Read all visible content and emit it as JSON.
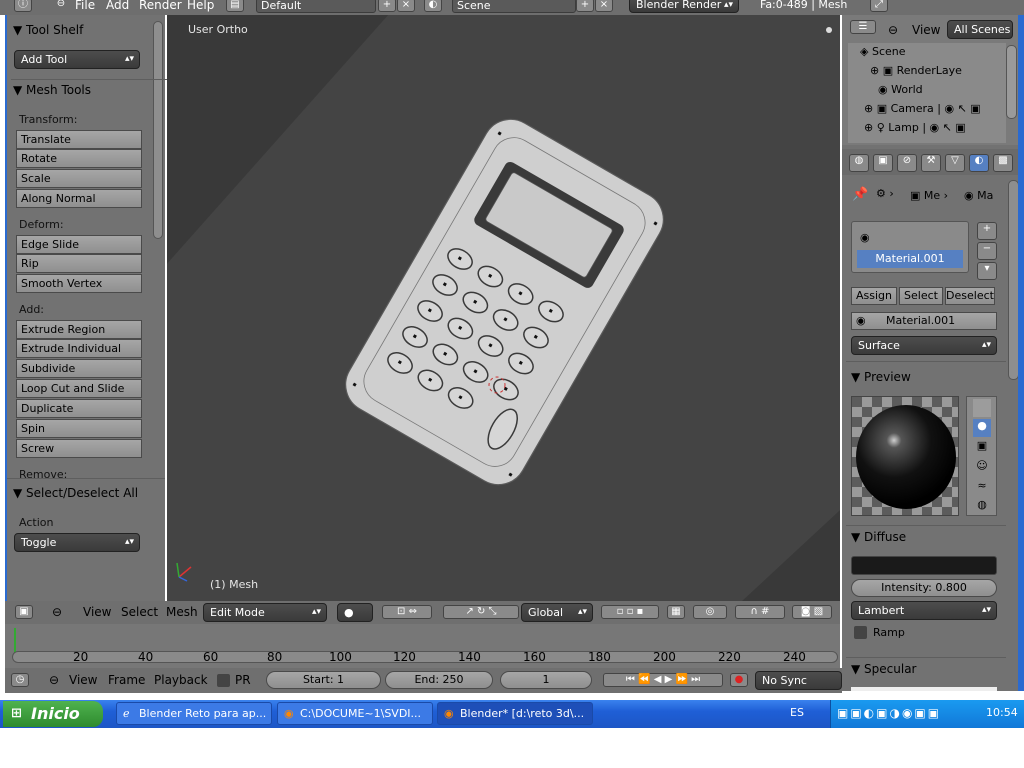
{
  "top_header": {
    "menus": [
      "File",
      "Add",
      "Render",
      "Help"
    ],
    "layout": "Default",
    "scene": "Scene",
    "engine": "Blender Render",
    "stats": "Fa:0-489 | Mesh"
  },
  "tool_shelf": {
    "title": "Tool Shelf",
    "add_tool": "Add Tool",
    "mesh_tools_title": "Mesh Tools",
    "transform_label": "Transform:",
    "transform": [
      "Translate",
      "Rotate",
      "Scale",
      "Along Normal"
    ],
    "deform_label": "Deform:",
    "deform": [
      "Edge Slide",
      "Rip",
      "Smooth Vertex"
    ],
    "add_label": "Add:",
    "add": [
      "Extrude Region",
      "Extrude Individual",
      "Subdivide",
      "Loop Cut and Slide",
      "Duplicate",
      "Spin",
      "Screw"
    ],
    "remove_label": "Remove:",
    "select_all_title": "Select/Deselect All",
    "action_label": "Action",
    "action_value": "Toggle"
  },
  "viewport": {
    "view_name": "User Ortho",
    "object_label": "(1) Mesh",
    "bg_color": "#393939",
    "model_color": "#c8c8c8"
  },
  "view3d_header": {
    "menus": [
      "View",
      "Select",
      "Mesh"
    ],
    "mode": "Edit Mode",
    "orientation": "Global"
  },
  "timeline": {
    "ticks": [
      "20",
      "40",
      "60",
      "80",
      "100",
      "120",
      "140",
      "160",
      "180",
      "200",
      "220",
      "240"
    ],
    "menus": [
      "View",
      "Frame",
      "Playback"
    ],
    "pr_label": "PR",
    "start": "Start: 1",
    "end": "End: 250",
    "current": "1",
    "sync": "No Sync"
  },
  "outliner": {
    "view": "View",
    "filter": "All Scenes",
    "items": [
      "Scene",
      "RenderLaye",
      "World",
      "Camera",
      "Lamp"
    ]
  },
  "properties": {
    "breadcrumb_me": "Me",
    "breadcrumb_ma": "Ma",
    "material_slot": "Material.001",
    "assign": "Assign",
    "select": "Select",
    "deselect": "Deselect",
    "material_name": "Material.001",
    "surface": "Surface",
    "preview_title": "Preview",
    "diffuse_title": "Diffuse",
    "intensity": "Intensity: 0.800",
    "shader": "Lambert",
    "ramp": "Ramp",
    "specular_title": "Specular",
    "diffuse_color": "#1a1a1a",
    "selected_slot_color": "#5680c2"
  },
  "taskbar": {
    "start": "Inicio",
    "tasks": [
      "Blender Reto para ap...",
      "C:\\DOCUME~1\\SVDI...",
      "Blender* [d:\\reto 3d\\..."
    ],
    "lang": "ES",
    "time": "10:54"
  }
}
